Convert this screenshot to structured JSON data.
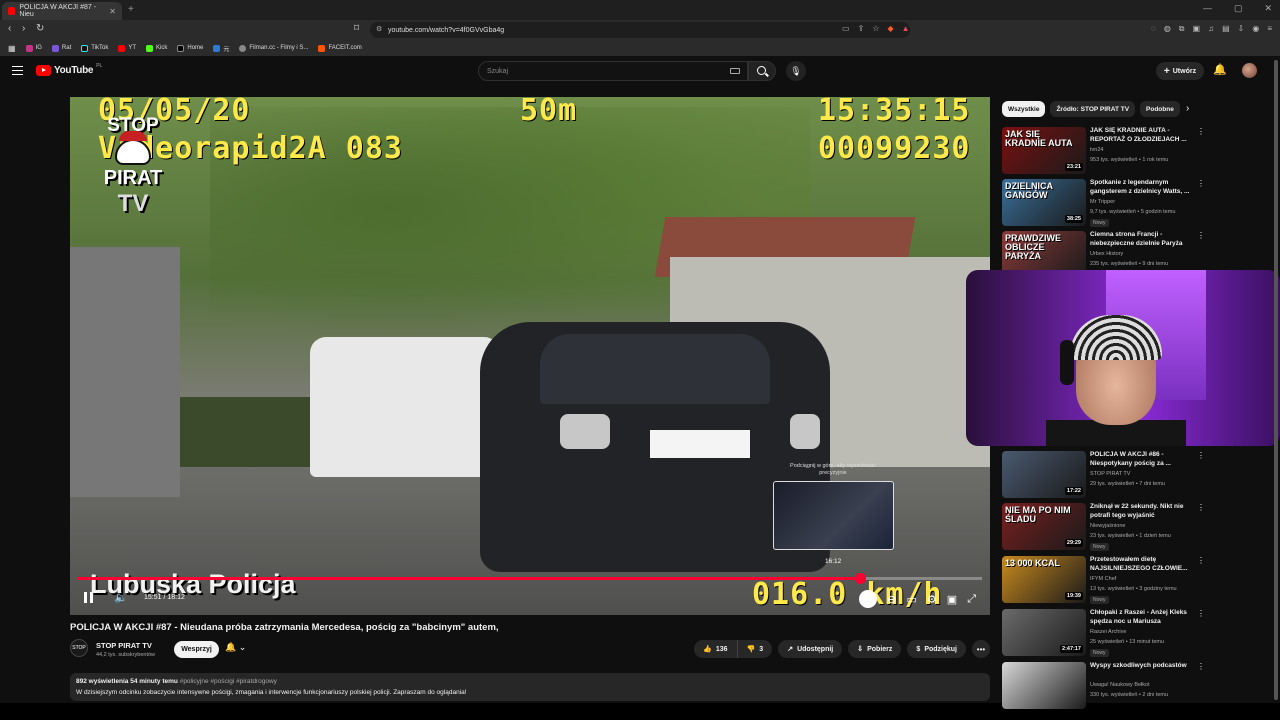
{
  "browser": {
    "tab_title": "POLICJA W AKCJI #87 - Nieu",
    "url": "youtube.com/watch?v=4f0GVvGba4g",
    "bookmarks": [
      {
        "label": "IG",
        "color": "#c13584"
      },
      {
        "label": "Rat",
        "color": "#7b57d8"
      },
      {
        "label": "TikTok",
        "color": "#111111"
      },
      {
        "label": "YT",
        "color": "#ff0000"
      },
      {
        "label": "Kick",
        "color": "#53fc18"
      },
      {
        "label": "Home",
        "color": "#000000"
      },
      {
        "label": "元",
        "color": "#2b7bd6"
      },
      {
        "label": "Filman.cc - Filmy i S...",
        "color": "#888888"
      },
      {
        "label": "FACEIT.com",
        "color": "#ff5500"
      }
    ]
  },
  "header": {
    "logo": "YouTube",
    "logo_region": "PL",
    "search_placeholder": "Szukaj",
    "create_label": "Utwórz"
  },
  "player": {
    "osd_date": "05/05/20",
    "osd_distance": "50m",
    "osd_time": "15:35:15",
    "osd_device": "Videorapid2A 083",
    "osd_counter": "00099230",
    "osd_speed": "016.0 km/h",
    "watermark_line1": "STOP",
    "watermark_line2": "PIRAT",
    "watermark_line3": "TV",
    "lower_text": "Lubuska Policja",
    "time_display": "15:51 / 18:12",
    "progress": 0.865,
    "preview_hint": "Podciągnij w górę, aby wyszukiwać precyzyjnie",
    "preview_time": "16:12"
  },
  "video": {
    "title": "POLICJA W AKCJI #87 - Nieudana próba zatrzymania Mercedesa, pościg za \"babcinym\" autem,",
    "channel": "STOP PIRAT TV",
    "subscribers": "44,2 tys. subskrybentów",
    "support_label": "Wesprzyj",
    "likes": "136",
    "dislikes": "3",
    "share_label": "Udostępnij",
    "download_label": "Pobierz",
    "thanks_label": "Podziękuj",
    "views": "892 wyświetlenia",
    "uploaded": "54 minuty temu",
    "hashtags": "#policyjne #pościgi #piratdrogowy",
    "description": "W dzisiejszym odcinku zobaczycie intensywne pościgi, zmagania i interwencje funkcjonariuszy polskiej policji. Zapraszam do oglądania!"
  },
  "sidebar": {
    "chips": [
      "Wszystkie",
      "Źródło: STOP PIRAT TV",
      "Podobne"
    ],
    "recommendations": [
      {
        "title": "JAK SIĘ KRADNIE AUTA - REPORTAŻ O ZŁODZIEJACH ...",
        "channel": "tvn24",
        "meta": "953 tys. wyświetleń • 1 rok temu",
        "duration": "23:21",
        "new": "",
        "thumb_text": "JAK SIĘ KRADNIE AUTA",
        "thumb_color": "#7a1010"
      },
      {
        "title": "Spotkanie z legendarnym gangsterem z dzielnicy Watts, ...",
        "channel": "Mr Tripper",
        "meta": "9,7 tys. wyświetleń • 5 godzin temu",
        "duration": "38:25",
        "new": "Nowy",
        "thumb_text": "DZIELNICA GANGÓW",
        "thumb_color": "#3a6f9a"
      },
      {
        "title": "Ciemna strona Francji - niebezpieczne dzielnie Paryża",
        "channel": "Urbex History",
        "meta": "235 tys. wyświetleń • 9 dni temu",
        "duration": "",
        "new": "",
        "thumb_text": "PRAWDZIWE OBLICZE PARYŻA",
        "thumb_color": "#8c3a3a"
      },
      {
        "title": "POLICJA W AKCJI #86 - Niespotykany pościg za ...",
        "channel": "STOP PIRAT TV",
        "meta": "29 tys. wyświetleń • 7 dni temu",
        "duration": "17:22",
        "new": "",
        "thumb_text": "",
        "thumb_color": "#4a5a70"
      },
      {
        "title": "Zniknął w 22 sekundy. Nikt nie potrafi tego wyjaśnić",
        "channel": "Niewyjaśnione",
        "meta": "23 tys. wyświetleń • 1 dzień temu",
        "duration": "29:29",
        "new": "Nowy",
        "thumb_text": "NIE MA PO NIM ŚLADU",
        "thumb_color": "#7a1f1f"
      },
      {
        "title": "Przetestowałem dietę NAJSILNIEJSZEGO CZŁOWIE...",
        "channel": "IFYM Chef",
        "meta": "13 tys. wyświetleń • 3 godziny temu",
        "duration": "19:39",
        "new": "Nowy",
        "thumb_text": "13 000 KCAL",
        "thumb_color": "#c98a1e"
      },
      {
        "title": "Chłopaki z Raszei - Anżej Kleks spędza noc u Mariusza",
        "channel": "Raszei Archive",
        "meta": "25 wyświetleń • 13 minut temu",
        "duration": "2:47:17",
        "new": "Nowy",
        "thumb_text": "",
        "thumb_color": "#6b6b6b"
      },
      {
        "title": "Wyspy szkodliwych podcastów",
        "channel": "Uwaga! Naukowy Bełkot",
        "meta": "330 tys. wyświetleń • 2 dni temu",
        "duration": "",
        "new": "",
        "thumb_text": "",
        "thumb_color": "#d8d8d8"
      }
    ]
  }
}
